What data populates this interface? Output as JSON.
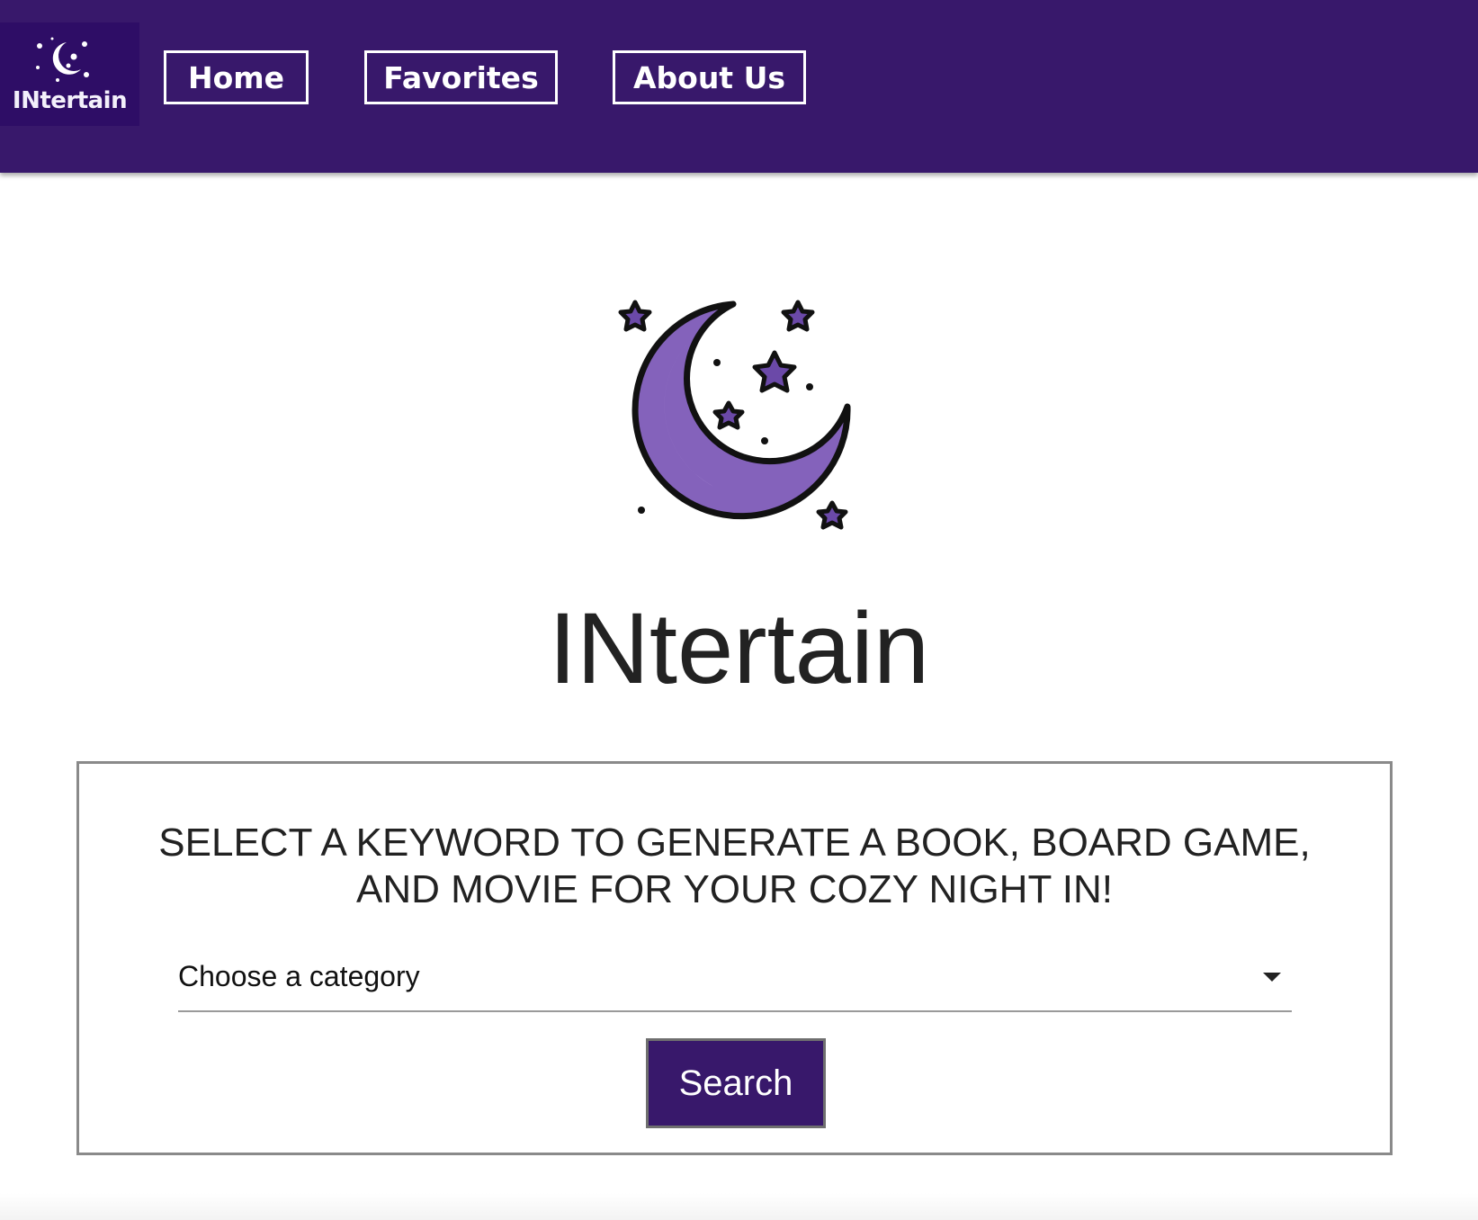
{
  "brand": {
    "logo_text": "INtertain",
    "logo_icon": "moon-stars-icon",
    "colors": {
      "navbar": "#38186b",
      "logo_bg": "#2e0d66",
      "moon": "#8462bb",
      "button": "#38186b"
    }
  },
  "nav": {
    "items": [
      {
        "label": "Home"
      },
      {
        "label": "Favorites"
      },
      {
        "label": "About Us"
      }
    ]
  },
  "hero": {
    "icon": "moon-stars-icon",
    "title": "INtertain"
  },
  "search_card": {
    "heading": "SELECT A KEYWORD TO GENERATE A BOOK, BOARD GAME, AND MOVIE FOR YOUR COZY NIGHT IN!",
    "category_select": {
      "selected": "Choose a category",
      "icon": "caret-down-icon"
    },
    "search_label": "Search"
  }
}
